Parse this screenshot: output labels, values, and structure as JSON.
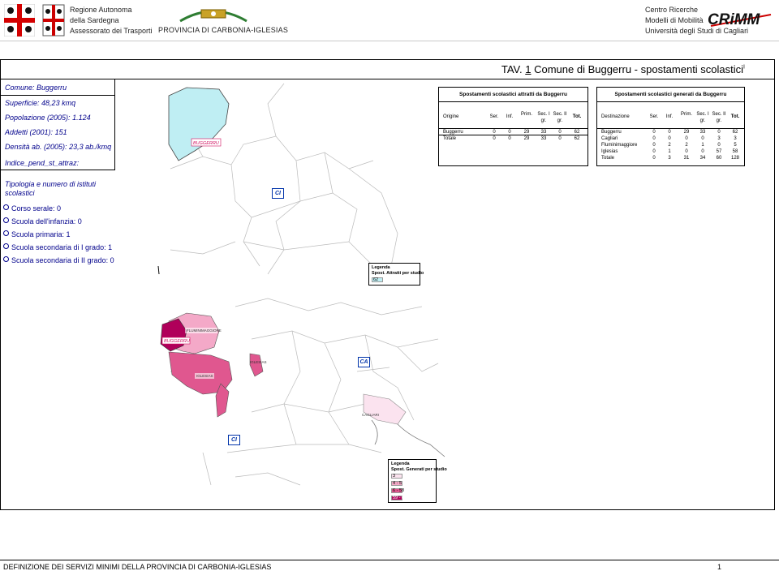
{
  "header": {
    "left_line1": "Regione Autonoma",
    "left_line2": "della Sardegna",
    "left_line3": "Assessorato dei Trasporti",
    "middle": "PROVINCIA DI CARBONIA-IGLESIAS",
    "right_line1": "Centro Ricerche",
    "right_line2": "Modelli di Mobilità",
    "right_line3": "Università degli Studi di Cagliari",
    "crimm_logo": "CRiMM"
  },
  "title": {
    "prefix": "TAV. ",
    "number": "1",
    "text": " Comune di Buggerru - spostamenti scolastici",
    "sup": "I"
  },
  "info": {
    "comune_label": "Comune:",
    "comune_value": "Buggerru",
    "superficie_label": "Superficie:",
    "superficie_value": "48,23 kmq",
    "popolazione_label": "Popolazione (2005):",
    "popolazione_value": "1.124",
    "addetti_label": "Addetti (2001):",
    "addetti_value": "151",
    "densita_label": "Densità ab. (2005):",
    "densita_value": "23,3 ab./kmq",
    "indice_label": "Indice_pend_st_attraz:"
  },
  "istituti": {
    "title": "Tipologia e numero di istituti scolastici",
    "items": [
      "Corso serale: 0",
      "Scuola dell'infanzia: 0",
      "Scuola primaria: 1",
      "Scuola secondaria di I grado: 1",
      "Scuola secondaria di II grado: 0"
    ]
  },
  "table_attratti": {
    "title": "Spostamenti scolastici attratti da Buggerru",
    "headers": [
      "Origine",
      "Ser.",
      "Inf.",
      "Prim.",
      "Sec. I gr.",
      "Sec. II gr.",
      "Tot."
    ],
    "rows": [
      [
        "Buggerru",
        "0",
        "0",
        "29",
        "33",
        "0",
        "62"
      ],
      [
        "Totale",
        "0",
        "0",
        "29",
        "33",
        "0",
        "62"
      ]
    ]
  },
  "table_generati": {
    "title": "Spostamenti scolastici generati da Buggerru",
    "headers": [
      "Destinazione",
      "Ser.",
      "Inf.",
      "Prim.",
      "Sec. I gr.",
      "Sec. II gr.",
      "Tot."
    ],
    "rows": [
      [
        "Buggerru",
        "0",
        "0",
        "29",
        "33",
        "0",
        "62"
      ],
      [
        "Cagliari",
        "0",
        "0",
        "0",
        "0",
        "3",
        "3"
      ],
      [
        "Fluminimaggiore",
        "0",
        "2",
        "2",
        "1",
        "0",
        "5"
      ],
      [
        "Iglesias",
        "0",
        "1",
        "0",
        "0",
        "57",
        "58"
      ],
      [
        "Totale",
        "0",
        "3",
        "31",
        "34",
        "60",
        "128"
      ]
    ]
  },
  "map1": {
    "label_buggerru": "BUGGERRU",
    "badge": "CI",
    "legend_title": "Legenda",
    "legend_sub": "Spost. Attratti per studio",
    "legend_items": [
      {
        "label": "62",
        "color": "#bfeef3"
      }
    ]
  },
  "map2": {
    "labels": {
      "fluminimaggiore": "FLUMINIMAGGIORE",
      "buggerru": "BUGGERRU",
      "iglesias_top": "IGLESIAS",
      "iglesias": "IGLESIAS",
      "cagliari": "CAGLIARI"
    },
    "badge_ca": "CA",
    "badge_ci": "CI",
    "legend_title": "Legenda",
    "legend_sub": "Spost. Generati per studio",
    "legend_items": [
      {
        "label": "3",
        "color": "#fbe3ef"
      },
      {
        "label": "4 - 5",
        "color": "#f4a9c8"
      },
      {
        "label": "6 - 58",
        "color": "#e0578f"
      },
      {
        "label": "59 - 62",
        "color": "#b0005a"
      }
    ]
  },
  "footer": {
    "text": "DEFINIZIONE DEI SERVIZI MINIMI DELLA PROVINCIA DI CARBONIA-IGLESIAS",
    "page": "1"
  }
}
